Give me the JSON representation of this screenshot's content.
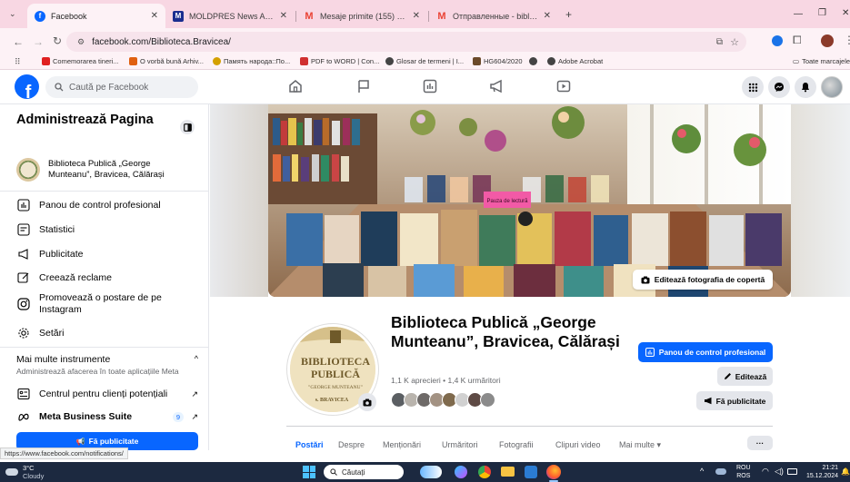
{
  "browser": {
    "tabs": [
      {
        "title": "Facebook",
        "active": true,
        "favicon_color": "#0866ff",
        "favicon": "f"
      },
      {
        "title": "MOLDPRES News Agency - A",
        "active": false,
        "favicon_color": "#1a2d8f",
        "favicon": "M"
      },
      {
        "title": "Mesaje primite (155) - angelaz",
        "active": false,
        "favicon_color": "#ea4335",
        "favicon": "M"
      },
      {
        "title": "Отправленные - bibliotecabra",
        "active": false,
        "favicon_color": "#ea4335",
        "favicon": "M"
      }
    ],
    "new_tab": "+",
    "url": "facebook.com/Biblioteca.Bravicea/",
    "bookmarks": [
      {
        "label": "Comemorarea tineri...",
        "color": "#e02020"
      },
      {
        "label": "O vorbă bună Arhiv...",
        "color": "#e06010"
      },
      {
        "label": "Память народа::По...",
        "color": "#d4a000"
      },
      {
        "label": "PDF to WORD | Con...",
        "color": "#d03030"
      },
      {
        "label": "Glosar de termeni | I...",
        "color": "#444444"
      },
      {
        "label": "HG604/2020",
        "color": "#6b4a2a"
      },
      {
        "label": "",
        "color": "#444444"
      },
      {
        "label": "Adobe Acrobat",
        "color": "#444444"
      }
    ],
    "bookmarks_folder": "Toate marcajele",
    "status_url": "https://www.facebook.com/notifications/"
  },
  "fb": {
    "search_placeholder": "Caută pe Facebook",
    "brand_color": "#0866ff"
  },
  "left": {
    "title": "Administrează Pagina",
    "page_name": "Biblioteca Publică „George Munteanu”, Bravicea, Călărași",
    "items": [
      {
        "label": "Panou de control profesional",
        "icon": "dashboard-icon"
      },
      {
        "label": "Statistici",
        "icon": "insights-icon"
      },
      {
        "label": "Publicitate",
        "icon": "megaphone-icon"
      },
      {
        "label": "Creează reclame",
        "icon": "edit-icon"
      },
      {
        "label": "Promovează o postare de pe Instagram",
        "icon": "instagram-icon"
      },
      {
        "label": "Setări",
        "icon": "gear-icon"
      }
    ],
    "more_tools": {
      "title": "Mai multe instrumente",
      "subtitle": "Administrează afacerea în toate aplicațiile Meta"
    },
    "tools": [
      {
        "label": "Centrul pentru clienți potențiali",
        "icon": "leads-icon",
        "badge": ""
      },
      {
        "label": "Meta Business Suite",
        "icon": "meta-icon",
        "badge": "9"
      }
    ],
    "promote_button": "Fă publicitate"
  },
  "page": {
    "cover_edit": "Editează fotografia de copertă",
    "cover_sign": "Pauza de lectură",
    "name": "Biblioteca Publică „George Munteanu”, Bravicea, Călărași",
    "stats": "1,1 K aprecieri • 1,4 K urmăritori",
    "profile_text": {
      "line1": "BIBLIOTECA",
      "line2": "PUBLICĂ",
      "line3": "\"GEORGE MUNTEANU\"",
      "line4": "s. BRAVICEA"
    },
    "buttons": {
      "dashboard": "Panou de control profesional",
      "edit": "Editează",
      "promote": "Fă publicitate"
    },
    "tabs": [
      "Postări",
      "Despre",
      "Menționări",
      "Urmăritori",
      "Fotografii",
      "Clipuri video",
      "Mai multe"
    ],
    "more_btn": "···"
  },
  "taskbar": {
    "weather_temp": "3°C",
    "weather_desc": "Cloudy",
    "search": "Căutați",
    "lang_top": "ROU",
    "lang_bottom": "ROS",
    "time": "21:21",
    "date": "15.12.2024"
  }
}
